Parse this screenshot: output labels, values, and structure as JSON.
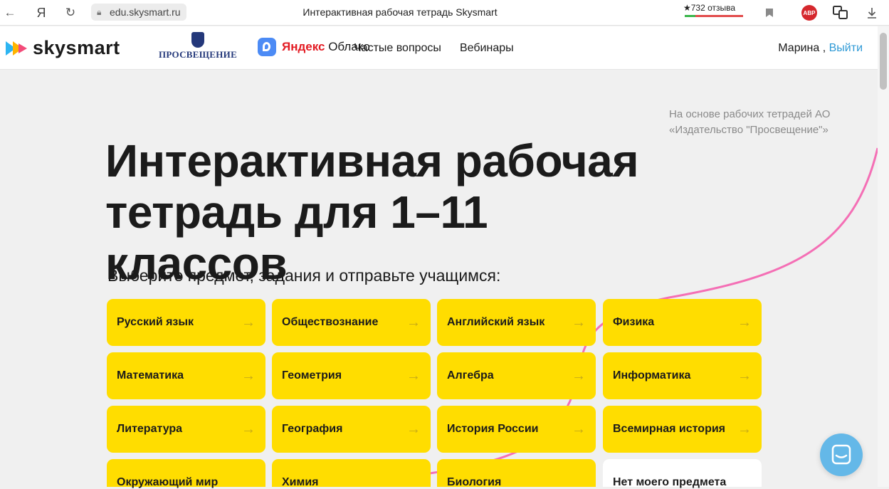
{
  "browser": {
    "url": "edu.skysmart.ru",
    "tab_title": "Интерактивная рабочая тетрадь Skysmart",
    "reviews_label": "★732 отзыва",
    "ya_label": "Я",
    "abp_label": "ABP"
  },
  "header": {
    "logo_text": "skysmart",
    "partner_prosv": "ПРОСВЕЩЕНИЕ",
    "partner_yandex_ya": "Яндекс",
    "partner_yandex_rest": " Облако",
    "nav": [
      "Частые вопросы",
      "Вебинары"
    ],
    "user_name": "Марина",
    "user_sep": " , ",
    "logout_label": "Выйти"
  },
  "hero": {
    "side_note": "На основе рабочих тетрадей АО «Издательство \"Просвещение\"»",
    "title_line1": "Интерактивная рабочая",
    "title_line2": "тетрадь для 1–11 классов",
    "subtitle": "Выберите предмет, задания и отправьте учащимся:"
  },
  "subjects": [
    "Русский язык",
    "Обществознание",
    "Английский язык",
    "Физика",
    "Математика",
    "Геометрия",
    "Алгебра",
    "Информатика",
    "Литература",
    "География",
    "История России",
    "Всемирная история",
    "Окружающий мир",
    "Химия",
    "Биология",
    "Нет моего предмета"
  ],
  "card_arrow": "→",
  "colors": {
    "accent_yellow": "#ffdd00",
    "link_blue": "#2f9ad6",
    "curve_pink": "#f46fb5",
    "chat_blue": "#64b8e8"
  }
}
